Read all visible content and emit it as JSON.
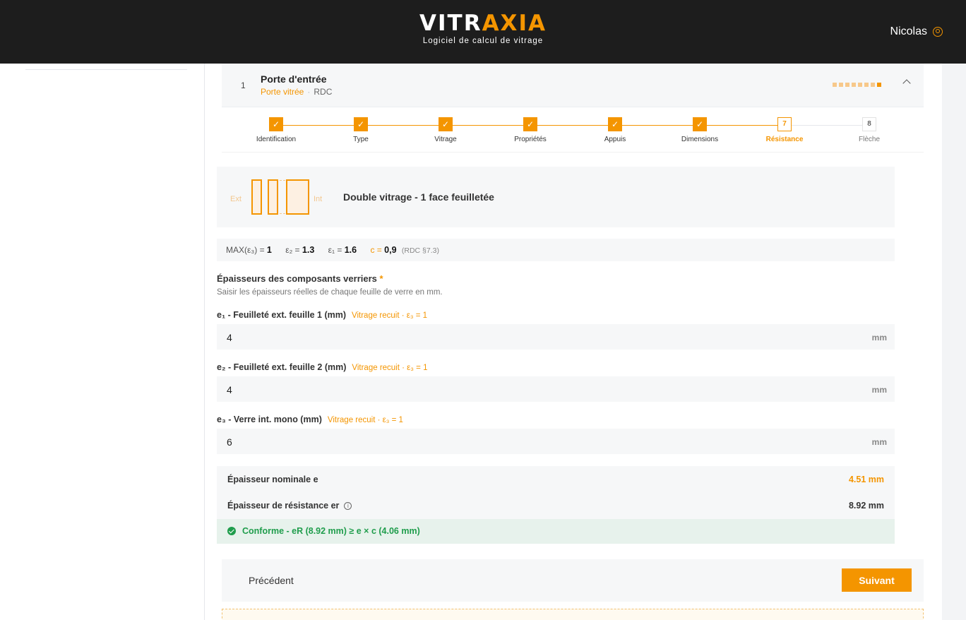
{
  "header": {
    "logo_part1": "VITR",
    "logo_part2": "AXIA",
    "tagline": "Logiciel de calcul de vitrage",
    "user_name": "Nicolas"
  },
  "item": {
    "number": "1",
    "title": "Porte d'entrée",
    "type": "Porte vitrée",
    "location": "RDC"
  },
  "steps": [
    {
      "label": "Identification",
      "state": "done",
      "mark": "✓"
    },
    {
      "label": "Type",
      "state": "done",
      "mark": "✓"
    },
    {
      "label": "Vitrage",
      "state": "done",
      "mark": "✓"
    },
    {
      "label": "Propriétés",
      "state": "done",
      "mark": "✓"
    },
    {
      "label": "Appuis",
      "state": "done",
      "mark": "✓"
    },
    {
      "label": "Dimensions",
      "state": "done",
      "mark": "✓"
    },
    {
      "label": "Résistance",
      "state": "current",
      "mark": "7"
    },
    {
      "label": "Flèche",
      "state": "todo",
      "mark": "8"
    }
  ],
  "diagram": {
    "ext_label": "Ext",
    "int_label": "Int",
    "title": "Double vitrage - 1 face feuilletée"
  },
  "formula": {
    "max_label": "MAX(ε₃) = ",
    "max_value": "1",
    "e2_label": "ε₂ = ",
    "e2_value": "1.3",
    "e1_label": "ε₁ = ",
    "e1_value": "1.6",
    "c_label": "c = ",
    "c_value": "0,9",
    "c_ref": "(RDC §7.3)"
  },
  "section": {
    "title": "Épaisseurs des composants verriers",
    "required_mark": "*",
    "help": "Saisir les épaisseurs réelles de chaque feuille de verre en mm."
  },
  "fields": [
    {
      "label": "e₁ - Feuilleté ext. feuille 1 (mm)",
      "hint": "Vitrage recuit · ε₃ = 1",
      "value": "4",
      "unit": "mm"
    },
    {
      "label": "e₂ - Feuilleté ext. feuille 2 (mm)",
      "hint": "Vitrage recuit · ε₃ = 1",
      "value": "4",
      "unit": "mm"
    },
    {
      "label": "e₃ - Verre int. mono (mm)",
      "hint": "Vitrage recuit · ε₃ = 1",
      "value": "6",
      "unit": "mm"
    }
  ],
  "results": {
    "nominal_label": "Épaisseur nominale e",
    "nominal_value": "4.51 mm",
    "resistance_label": "Épaisseur de résistance er",
    "resistance_value": "8.92 mm",
    "conform_text": "Conforme - eR (8.92 mm) ≥ e × c (4.06 mm)"
  },
  "colors": {
    "accent": "#f49500",
    "success": "#1f9d4c",
    "header_bg": "#1d1d1d"
  },
  "footer": {
    "prev_label": "Précédent",
    "next_label": "Suivant"
  }
}
